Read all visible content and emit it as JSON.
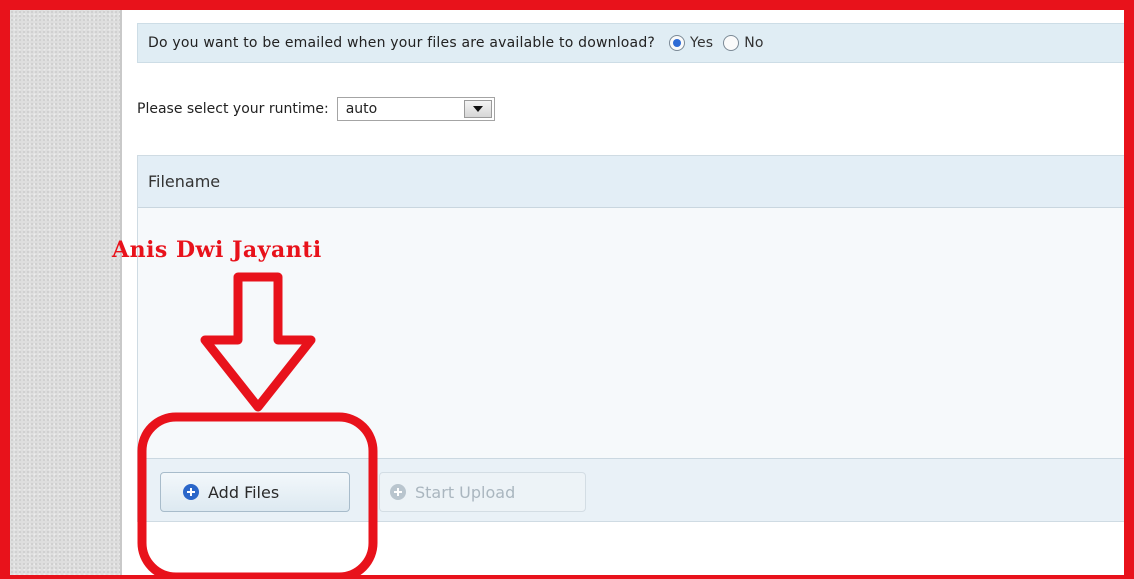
{
  "email_notify": {
    "question": "Do you want to be emailed when your files are available to download?",
    "options": [
      {
        "label": "Yes",
        "selected": true
      },
      {
        "label": "No",
        "selected": false
      }
    ]
  },
  "runtime": {
    "label": "Please select your runtime:",
    "selected": "auto"
  },
  "uploader": {
    "column_header": "Filename",
    "files": [],
    "add_files_label": "Add Files",
    "start_upload_label": "Start Upload",
    "start_upload_enabled": false
  },
  "annotation": {
    "text": "Anis Dwi Jayanti",
    "color": "#e8121b"
  },
  "colors": {
    "accent_blue": "#2a66c9",
    "panel_header_bg": "#e3eef6",
    "email_bar_bg": "#e0edf4"
  },
  "icons": {
    "add_files": "plus-circle-icon",
    "start_upload": "arrow-circle-icon",
    "select": "chevron-down-icon"
  }
}
